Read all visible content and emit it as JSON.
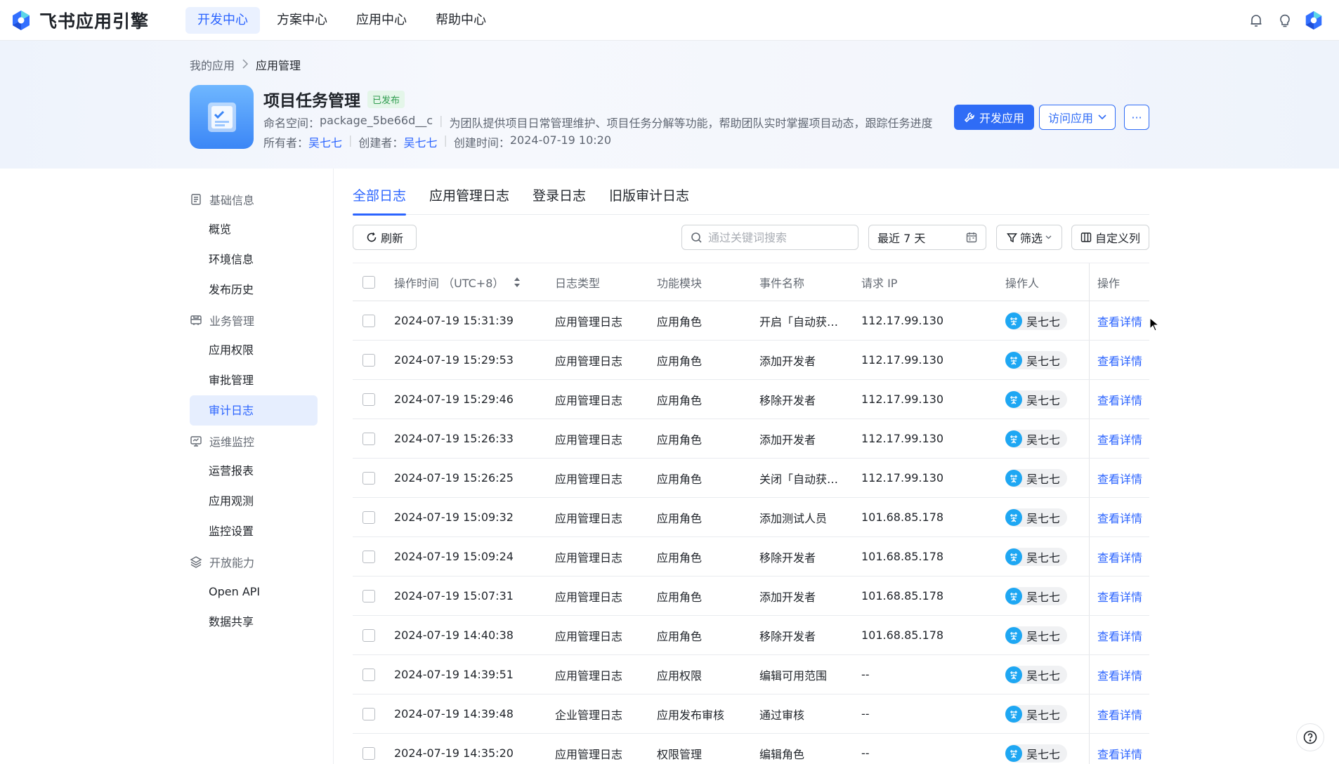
{
  "brand": {
    "name": "飞书应用引擎"
  },
  "nav": {
    "items": [
      "开发中心",
      "方案中心",
      "应用中心",
      "帮助中心"
    ],
    "active": 0
  },
  "breadcrumb": {
    "parent": "我的应用",
    "current": "应用管理"
  },
  "app": {
    "title": "项目任务管理",
    "status": "已发布",
    "namespace_label": "命名空间：",
    "namespace": "package_5be66d__c",
    "description": "为团队提供项目日常管理维护、项目任务分解等功能，帮助团队实时掌握项目动态，跟踪任务进度",
    "owner_label": "所有者：",
    "owner": "吴七七",
    "creator_label": "创建者：",
    "creator": "吴七七",
    "created_label": "创建时间：",
    "created": "2024-07-19 10:20"
  },
  "actions": {
    "develop": "开发应用",
    "visit": "访问应用",
    "more": "···"
  },
  "sidebar": {
    "groups": [
      {
        "label": "基础信息",
        "icon": "document-icon",
        "items": [
          "概览",
          "环境信息",
          "发布历史"
        ]
      },
      {
        "label": "业务管理",
        "icon": "briefcase-icon",
        "items": [
          "应用权限",
          "审批管理",
          "审计日志"
        ]
      },
      {
        "label": "运维监控",
        "icon": "monitor-icon",
        "items": [
          "运营报表",
          "应用观测",
          "监控设置"
        ]
      },
      {
        "label": "开放能力",
        "icon": "layers-icon",
        "items": [
          "Open API",
          "数据共享"
        ]
      }
    ],
    "active": "审计日志"
  },
  "tabs": {
    "items": [
      "全部日志",
      "应用管理日志",
      "登录日志",
      "旧版审计日志"
    ],
    "active": 0
  },
  "toolbar": {
    "refresh": "刷新",
    "search_placeholder": "通过关键词搜索",
    "date_range": "最近 7 天",
    "filter": "筛选",
    "columns": "自定义列"
  },
  "table": {
    "headers": {
      "time": "操作时间 （UTC+8）",
      "type": "日志类型",
      "module": "功能模块",
      "event": "事件名称",
      "ip": "请求 IP",
      "operator": "操作人",
      "action": "操作"
    },
    "rows": [
      {
        "time": "2024-07-19 15:31:39",
        "type": "应用管理日志",
        "module": "应用角色",
        "event": "开启「自动获…",
        "ip": "112.17.99.130",
        "operator": "吴七七",
        "action": "查看详情"
      },
      {
        "time": "2024-07-19 15:29:53",
        "type": "应用管理日志",
        "module": "应用角色",
        "event": "添加开发者",
        "ip": "112.17.99.130",
        "operator": "吴七七",
        "action": "查看详情"
      },
      {
        "time": "2024-07-19 15:29:46",
        "type": "应用管理日志",
        "module": "应用角色",
        "event": "移除开发者",
        "ip": "112.17.99.130",
        "operator": "吴七七",
        "action": "查看详情"
      },
      {
        "time": "2024-07-19 15:26:33",
        "type": "应用管理日志",
        "module": "应用角色",
        "event": "添加开发者",
        "ip": "112.17.99.130",
        "operator": "吴七七",
        "action": "查看详情"
      },
      {
        "time": "2024-07-19 15:26:25",
        "type": "应用管理日志",
        "module": "应用角色",
        "event": "关闭「自动获…",
        "ip": "112.17.99.130",
        "operator": "吴七七",
        "action": "查看详情"
      },
      {
        "time": "2024-07-19 15:09:32",
        "type": "应用管理日志",
        "module": "应用角色",
        "event": "添加测试人员",
        "ip": "101.68.85.178",
        "operator": "吴七七",
        "action": "查看详情"
      },
      {
        "time": "2024-07-19 15:09:24",
        "type": "应用管理日志",
        "module": "应用角色",
        "event": "移除开发者",
        "ip": "101.68.85.178",
        "operator": "吴七七",
        "action": "查看详情"
      },
      {
        "time": "2024-07-19 15:07:31",
        "type": "应用管理日志",
        "module": "应用角色",
        "event": "添加开发者",
        "ip": "101.68.85.178",
        "operator": "吴七七",
        "action": "查看详情"
      },
      {
        "time": "2024-07-19 14:40:38",
        "type": "应用管理日志",
        "module": "应用角色",
        "event": "移除开发者",
        "ip": "101.68.85.178",
        "operator": "吴七七",
        "action": "查看详情"
      },
      {
        "time": "2024-07-19 14:39:51",
        "type": "应用管理日志",
        "module": "应用权限",
        "event": "编辑可用范围",
        "ip": "--",
        "operator": "吴七七",
        "action": "查看详情"
      },
      {
        "time": "2024-07-19 14:39:48",
        "type": "企业管理日志",
        "module": "应用发布审核",
        "event": "通过审核",
        "ip": "--",
        "operator": "吴七七",
        "action": "查看详情"
      },
      {
        "time": "2024-07-19 14:35:20",
        "type": "应用管理日志",
        "module": "权限管理",
        "event": "编辑角色",
        "ip": "--",
        "operator": "吴七七",
        "action": "查看详情"
      }
    ]
  },
  "colors": {
    "accent": "#2b64ff",
    "primary_button": "#2f6cf6",
    "published_badge": "#2f9c4f",
    "avatar": "#1ea7f3"
  }
}
